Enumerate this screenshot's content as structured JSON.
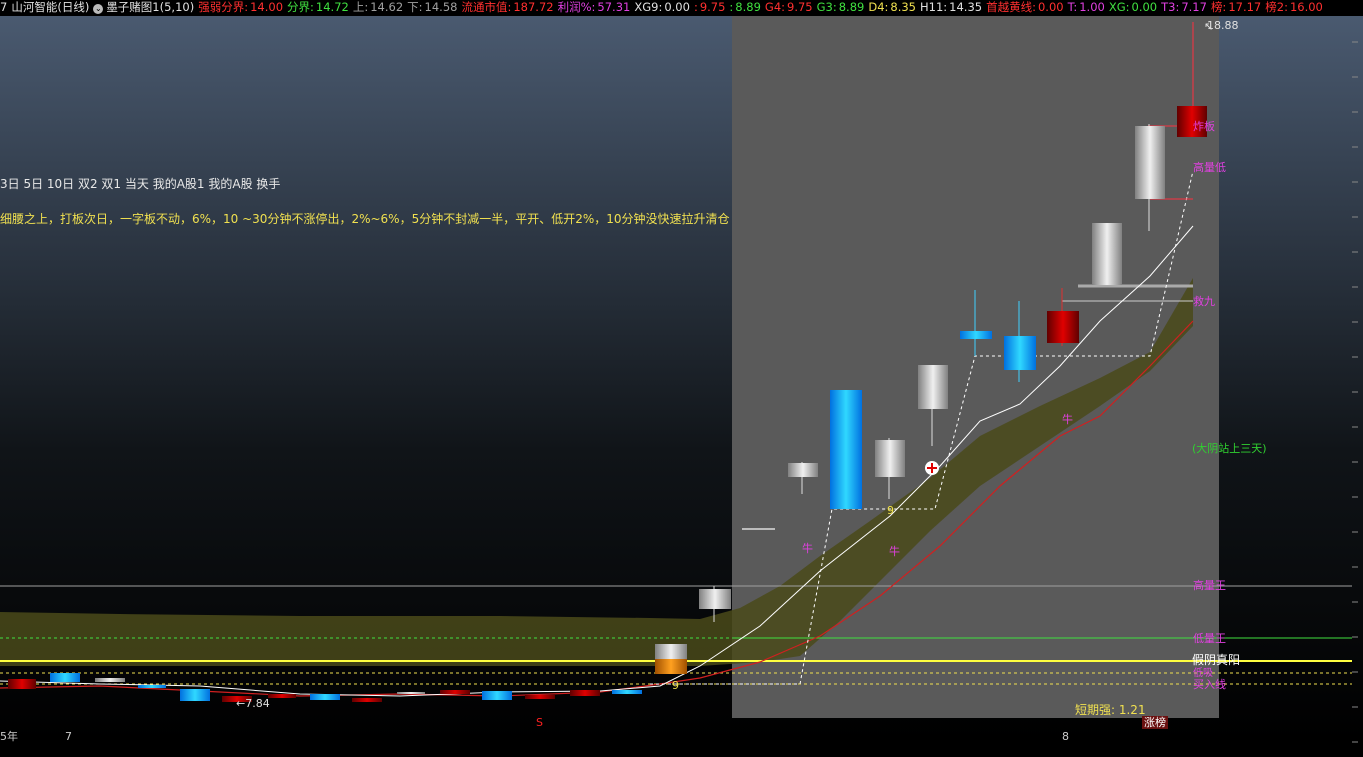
{
  "header": {
    "code": "7",
    "stock_name": "山河智能(日线)",
    "formula_icon": "settings-circle-icon",
    "formula_name": "墨子赌图1(5,10)",
    "items": [
      {
        "label": "强弱分界:",
        "value": "14.00",
        "color": "#ff3030"
      },
      {
        "label": "分界:",
        "value": "14.72",
        "color": "#40e040"
      },
      {
        "label": "上:",
        "value": "14.62",
        "color": "#a0a0a0"
      },
      {
        "label": "下:",
        "value": "14.58",
        "color": "#a0a0a0"
      },
      {
        "label": "流通市值:",
        "value": "187.72",
        "color": "#ff3030"
      },
      {
        "label": "利润%:",
        "value": "57.31",
        "color": "#e040e0"
      },
      {
        "label": "XG9:",
        "value": "0.00",
        "color": "#e0e0e0"
      },
      {
        "label": ":",
        "value": "9.75",
        "color": "#ff3030"
      },
      {
        "label": ":",
        "value": "8.89",
        "color": "#40e040"
      },
      {
        "label": "G4:",
        "value": "9.75",
        "color": "#ff3030"
      },
      {
        "label": "G3:",
        "value": "8.89",
        "color": "#40e040"
      },
      {
        "label": "D4:",
        "value": "8.35",
        "color": "#f0e050"
      },
      {
        "label": "H11:",
        "value": "14.35",
        "color": "#e0e0e0"
      },
      {
        "label": "首越黄线:",
        "value": "0.00",
        "color": "#ff3030"
      },
      {
        "label": "T:",
        "value": "1.00",
        "color": "#e040e0"
      },
      {
        "label": "XG:",
        "value": "0.00",
        "color": "#40e040"
      },
      {
        "label": "T3:",
        "value": "7.17",
        "color": "#e040e0"
      },
      {
        "label": "榜:",
        "value": "17.17",
        "color": "#ff3030"
      },
      {
        "label": "榜2:",
        "value": "16.00",
        "color": "#ff3030"
      }
    ]
  },
  "indicator_legend": "3日 5日 10日 双2 双1 当天 我的A股1 我的A股 换手",
  "strategy_note": "细腰之上，打板次日，一字板不动，6%，10 ~30分钟不涨停出，2%~6%，5分钟不封减一半，平开、低开2%，10分钟没快速拉升清仓",
  "chart_labels": {
    "max_price": "18.88",
    "min_price": "7.84",
    "zhaban": "炸板",
    "gaoliangdi": "高量低",
    "jiujiu": "救九",
    "dayin": "(大阴站上三天)",
    "gaoliang_wang": "高量王",
    "diliang_wang": "低量王",
    "jiayin_zhenyang": "假阴真阳",
    "gaozhui": "低吸",
    "buy_line": "买入线",
    "short_strength": "短期强: 1.21",
    "zhangbang": "涨榜",
    "niu": "牛",
    "nine": "9",
    "s_mark": "S",
    "date_left": "5年",
    "date_7": "7",
    "date_8": "8"
  },
  "colors": {
    "up": "#ff2020",
    "down": "#20c0ff",
    "ma_white": "#ffffff",
    "band": "#4a4a1a",
    "highlight_bg": "#5a5a5a",
    "magenta": "#e040e0",
    "green": "#30d030",
    "yellow": "#f0e050"
  }
}
